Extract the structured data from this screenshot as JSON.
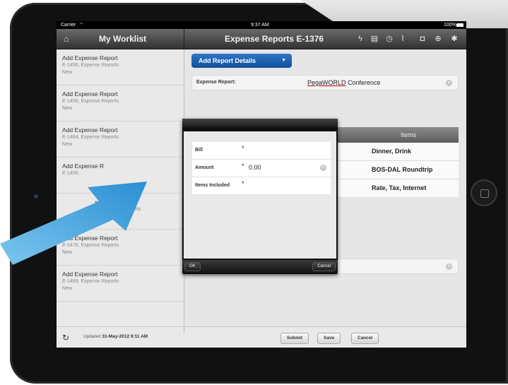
{
  "status_bar": {
    "carrier": "Carrier",
    "time": "9:37 AM",
    "battery": "100%"
  },
  "nav": {
    "left_title": "My Worklist",
    "right_title": "Expense Reports E-1376"
  },
  "icons": {
    "home": "home-icon",
    "flash": "lightning-icon",
    "document": "document-icon",
    "history": "clock-icon",
    "attachment": "paperclip-icon",
    "camera": "camera-icon",
    "add": "add-document-icon",
    "settings": "gear-icon",
    "refresh": "refresh-icon"
  },
  "worklist": [
    {
      "title": "Add Expense Report",
      "subtitle": "E-1456, Expense Reports",
      "status": "New"
    },
    {
      "title": "Add Expense Report",
      "subtitle": "E-1458, Expense Reports",
      "status": "New"
    },
    {
      "title": "Add Expense Report",
      "subtitle": "E-1464, Expense Reports",
      "status": "New"
    },
    {
      "title": "Add Expense R",
      "subtitle": "E-1496,",
      "status": ""
    },
    {
      "title": "se Report",
      "subtitle": "66, Expense Reports",
      "status": "New"
    },
    {
      "title": "Add Expense Report",
      "subtitle": "E-1476, Expense Reports",
      "status": "New"
    },
    {
      "title": "Add Expense Report",
      "subtitle": "E-1489, Expense Reports",
      "status": "New"
    }
  ],
  "sidebar_footer": {
    "updated_prefix": "Updated ",
    "updated_value": "31-May-2012 9:11 AM"
  },
  "main": {
    "add_details_button": "Add Report Details",
    "expense_report_label": "Expense Report:",
    "expense_report_value_underlined": "PegaWORLD",
    "expense_report_value_rest": " Conference",
    "items_header": "Items",
    "items": [
      "Dinner, Drink",
      "BOS-DAL Roundtrip",
      "Rate, Tax, Internet"
    ]
  },
  "dialog": {
    "fields": [
      {
        "label": "Bill",
        "required": "*",
        "value": ""
      },
      {
        "label": "Amount",
        "required": "*",
        "value": "0.00"
      },
      {
        "label": "Items Included",
        "required": "*",
        "value": ""
      }
    ],
    "ok_label": "OK",
    "cancel_label": "Cancel"
  },
  "footer_buttons": {
    "submit": "Submit",
    "save": "Save",
    "cancel": "Cancel"
  },
  "colors": {
    "accent": "#1a5fb0",
    "arrow": "#2e9ad8"
  }
}
